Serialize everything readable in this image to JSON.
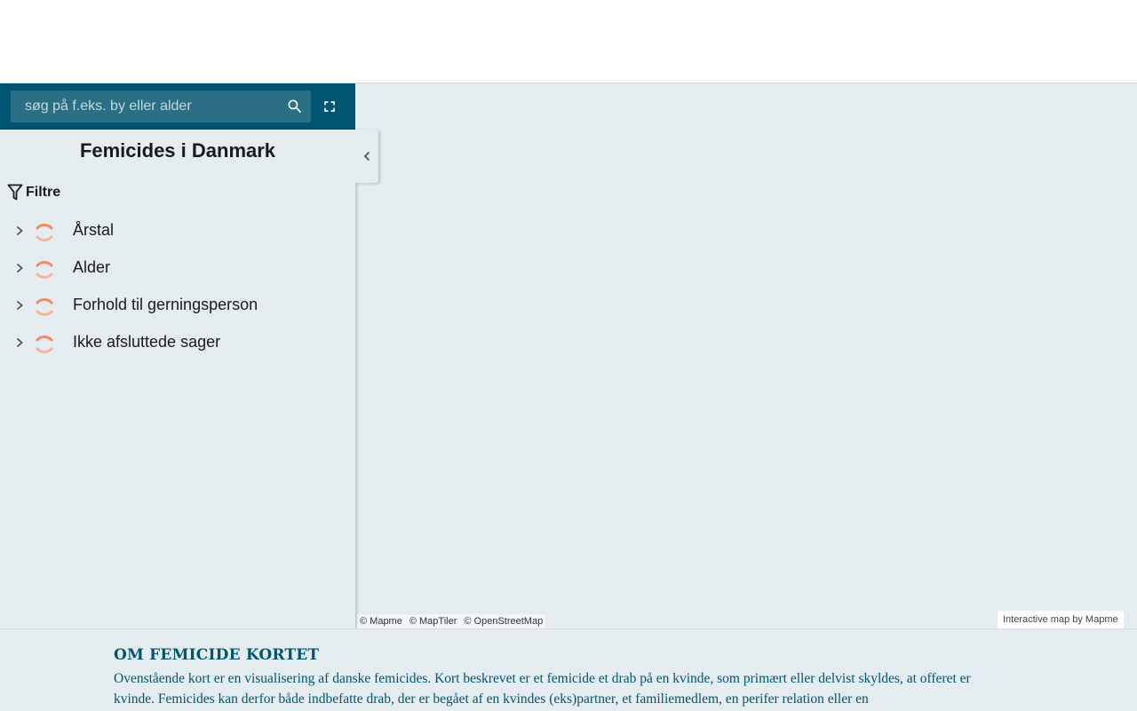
{
  "search": {
    "placeholder": "søg på f.eks. by eller alder"
  },
  "icons": {
    "search": "search-icon",
    "fullscreen": "fullscreen-icon",
    "collapse": "chevron-left-icon",
    "filter": "filter-icon",
    "expand": "chevron-right-icon",
    "loading": "loading-spinner-icon"
  },
  "panel": {
    "title": "Femicides i Danmark",
    "filters_label": "Filtre",
    "filters": [
      {
        "label": "Årstal"
      },
      {
        "label": "Alder"
      },
      {
        "label": "Forhold til gerningsperson"
      },
      {
        "label": "Ikke afsluttede sager"
      }
    ]
  },
  "attribution": {
    "mapme": "© Mapme",
    "maptiler": "© MapTiler",
    "osm": "© OpenStreetMap",
    "credit": "Interactive map by Mapme"
  },
  "about": {
    "heading": "OM FEMICIDE KORTET",
    "text": "Ovenstående kort er en visualisering af danske femicides. Kort beskrevet er et femicide et drab på en kvinde, som primært eller delvist skyldes, at offeret er kvinde. Femicides kan derfor både indbefatte drab, der er begået af en kvindes (eks)partner, et familiemedlem, en perifer relation eller en"
  },
  "colors": {
    "header_blue": "#005670",
    "search_field": "#2b6f85",
    "map_background": "#e4ecef",
    "spinner": "#f08a60",
    "about_text": "#005670"
  }
}
